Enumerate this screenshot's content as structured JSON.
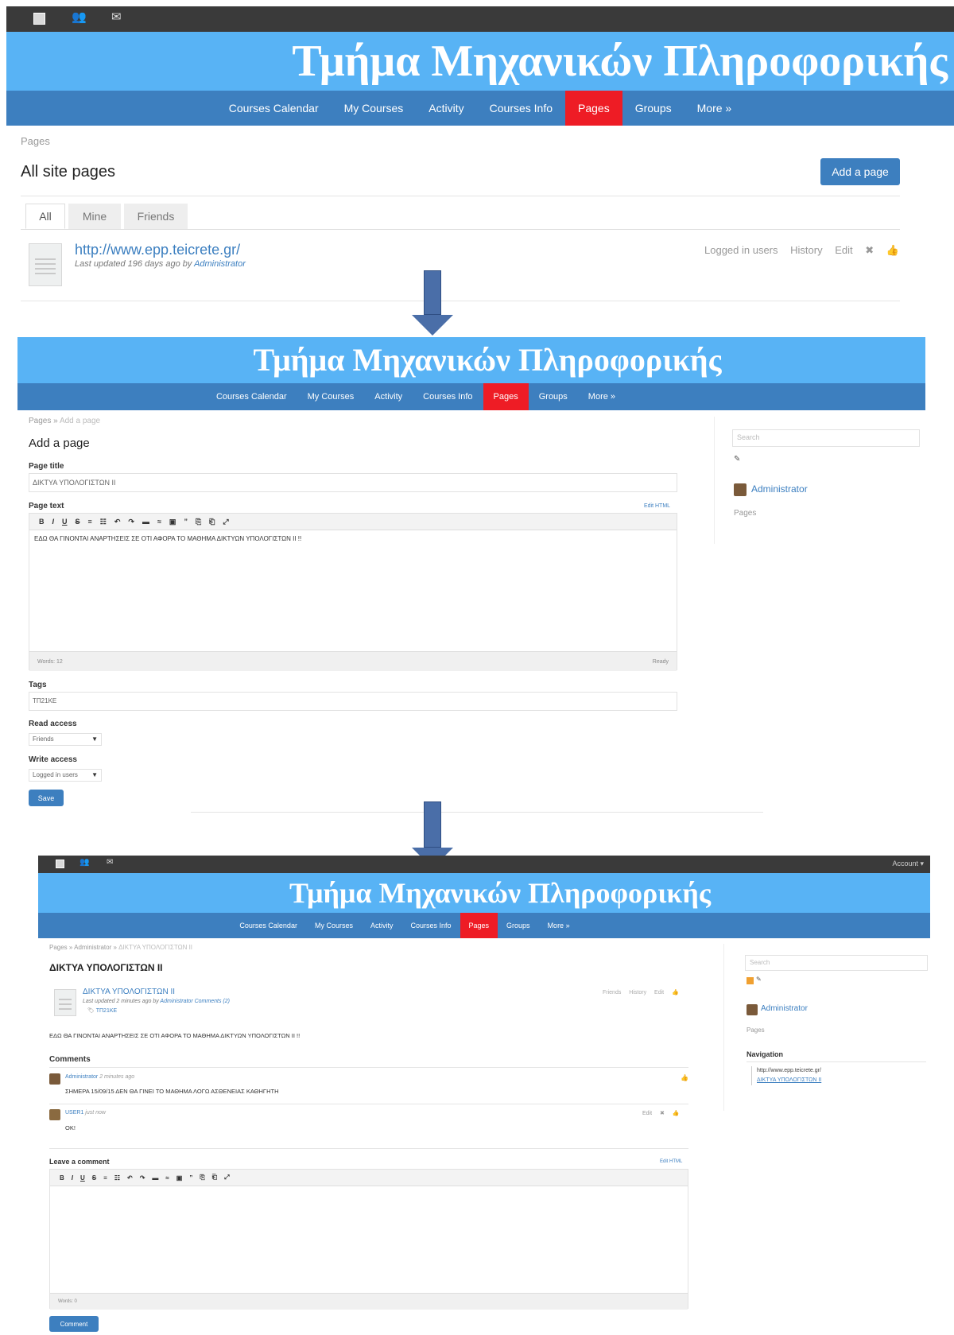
{
  "site": {
    "title": "Τμήμα Μηχανικών Πληροφορικής",
    "account_label": "Account ▾"
  },
  "nav": {
    "items": [
      "Courses Calendar",
      "My Courses",
      "Activity",
      "Courses Info",
      "Pages",
      "Groups",
      "More »"
    ],
    "active": "Pages"
  },
  "panel1": {
    "breadcrumb": "Pages",
    "title": "All site pages",
    "add_button": "Add a page",
    "tabs": [
      "All",
      "Mine",
      "Friends"
    ],
    "page_link": "http://www.epp.teicrete.gr/",
    "updated_prefix": "Last updated 196 days ago by",
    "updated_author": "Administrator",
    "actions": [
      "Logged in users",
      "History",
      "Edit"
    ]
  },
  "panel2": {
    "breadcrumb_parent": "Pages",
    "breadcrumb_sep": " » ",
    "breadcrumb_current": "Add a page",
    "title": "Add a page",
    "page_title_label": "Page title",
    "page_title_value": "ΔΙΚΤΥΑ ΥΠΟΛΟΓΙΣΤΩΝ ΙΙ",
    "page_text_label": "Page text",
    "edit_html": "Edit HTML",
    "editor_text": "ΕΔΩ ΘΑ ΓΙΝΟΝΤΑΙ ΑΝΑΡΤΗΣΕΙΣ ΣΕ ΟΤΙ ΑΦΟΡΑ ΤΟ ΜΑΘΗΜΑ ΔΙΚΤΥΩΝ ΥΠΟΛΟΓΙΣΤΩΝ ΙΙ !!",
    "words": "Words: 12",
    "ready": "Ready",
    "tags_label": "Tags",
    "tags_value": "ΤΠ21ΚΕ",
    "read_access_label": "Read access",
    "read_access_value": "Friends",
    "write_access_label": "Write access",
    "write_access_value": "Logged in users",
    "save_button": "Save",
    "search_placeholder": "Search",
    "sidebar_user": "Administrator",
    "sidebar_pages": "Pages"
  },
  "panel3": {
    "breadcrumb_parent": "Pages",
    "breadcrumb_user": "Administrator",
    "breadcrumb_sep": " » ",
    "breadcrumb_current": "ΔΙΚΤΥΑ ΥΠΟΛΟΓΙΣΤΩΝ ΙΙ",
    "title": "ΔΙΚΤΥΑ ΥΠΟΛΟΓΙΣΤΩΝ ΙΙ",
    "page_link": "ΔΙΚΤΥΑ ΥΠΟΛΟΓΙΣΤΩΝ ΙΙ",
    "updated_prefix": "Last updated 2 minutes ago by",
    "updated_author": "Administrator",
    "comments_link": "Comments (2)",
    "tag": "ΤΠ21ΚΕ",
    "actions": [
      "Friends",
      "History",
      "Edit"
    ],
    "body_text": "ΕΔΩ ΘΑ ΓΙΝΟΝΤΑΙ ΑΝΑΡΤΗΣΕΙΣ ΣΕ ΟΤΙ ΑΦΟΡΑ ΤΟ ΜΑΘΗΜΑ ΔΙΚΤΥΩΝ ΥΠΟΛΟΓΙΣΤΩΝ ΙΙ !!",
    "comments_heading": "Comments",
    "comment1_author": "Administrator",
    "comment1_time": "2 minutes ago",
    "comment1_text": "ΣΗΜΕΡΑ 15/09/15 ΔΕΝ ΘΑ ΓΙΝΕΙ ΤΟ ΜΑΘΗΜΑ ΛΟΓΩ ΑΣΘΕΝΕΙΑΣ ΚΑΘΗΓΗΤΗ",
    "comment2_author": "USER1",
    "comment2_time": "just now",
    "comment2_text": "OK!",
    "comment2_edit": "Edit",
    "leave_comment": "Leave a comment",
    "edit_html": "Edit HTML",
    "words": "Words: 0",
    "comment_button": "Comment",
    "search_placeholder": "Search",
    "sidebar_user": "Administrator",
    "sidebar_pages": "Pages",
    "navigation_heading": "Navigation",
    "nav_link1": "http://www.epp.teicrete.gr/",
    "nav_link2": "ΔΙΚΤΥΑ ΥΠΟΛΟΓΙΣΤΩΝ ΙΙ"
  },
  "toolbar": {
    "buttons": [
      "B",
      "I",
      "U",
      "S",
      "≡",
      "☷",
      "↶",
      "↷",
      "▬",
      "≈",
      "▣",
      "”",
      "⎘",
      "⎗",
      "⤢"
    ]
  },
  "icons": [
    "user-icon",
    "friends-icon",
    "messages-icon",
    "like-icon",
    "delete-icon",
    "rss-icon",
    "bookmark-icon",
    "document-icon",
    "arrow-down-icon"
  ],
  "colors": {
    "banner": "#58b3f5",
    "nav": "#3d7fbf",
    "active_nav": "#ee1c25",
    "topbar": "#3a3a3a",
    "link": "#3c7fc0",
    "arrow": "#4a6ea8"
  }
}
